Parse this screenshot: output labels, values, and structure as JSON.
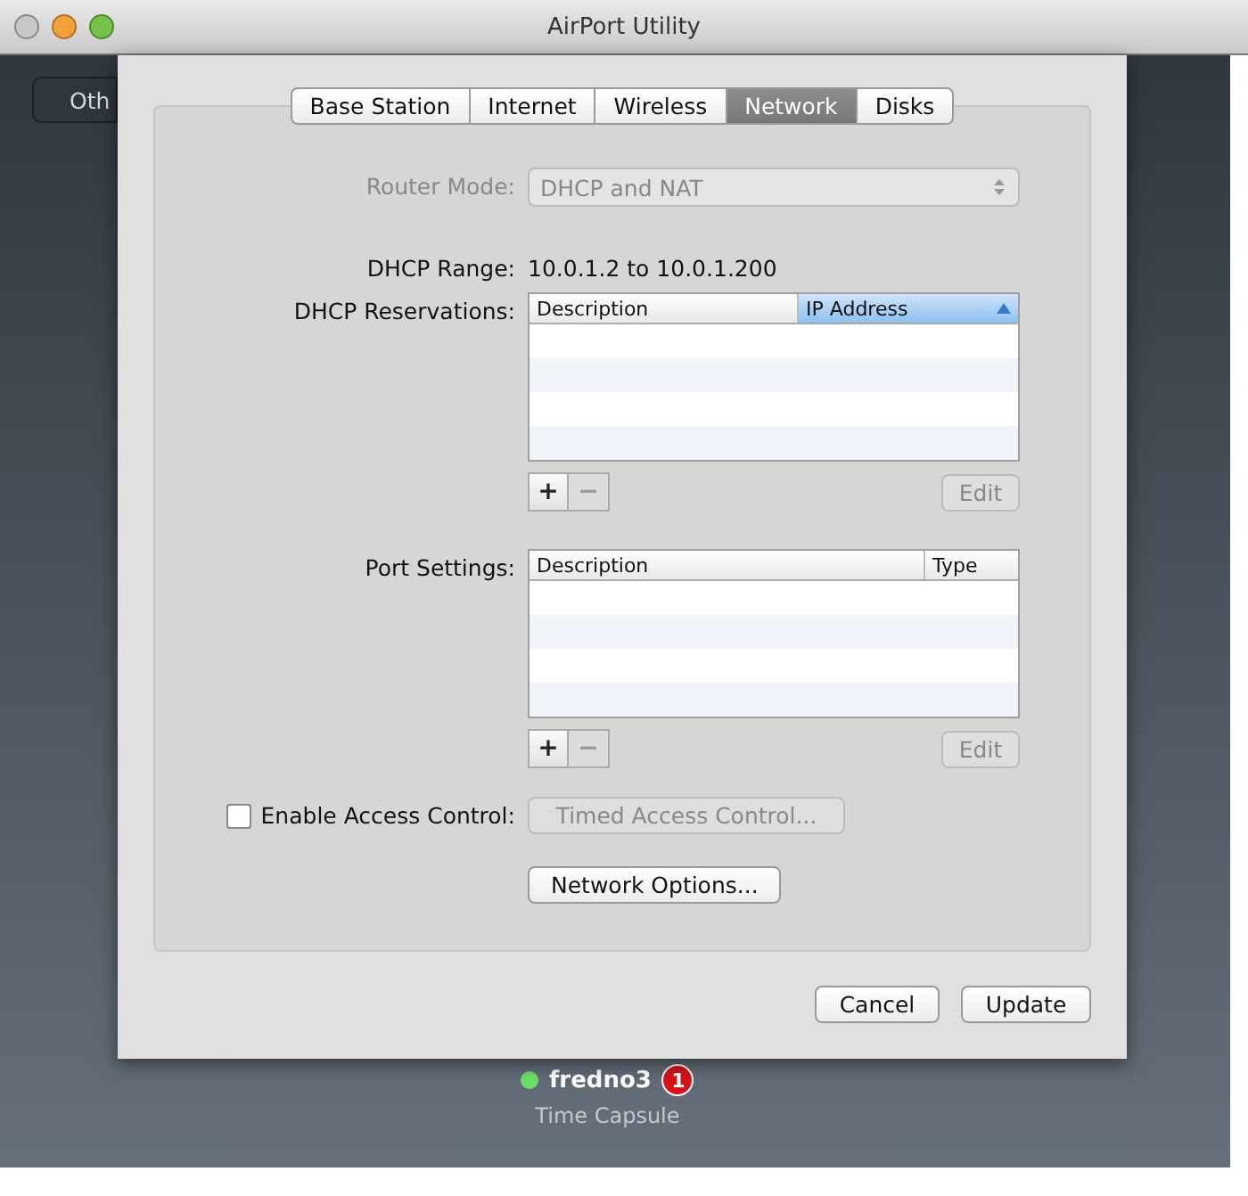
{
  "window": {
    "title": "AirPort Utility"
  },
  "background": {
    "button": "Oth",
    "device_name": "fredno3",
    "badge": "1",
    "device_model": "Time Capsule"
  },
  "tabs": [
    {
      "label": "Base Station",
      "selected": false
    },
    {
      "label": "Internet",
      "selected": false
    },
    {
      "label": "Wireless",
      "selected": false
    },
    {
      "label": "Network",
      "selected": true
    },
    {
      "label": "Disks",
      "selected": false
    }
  ],
  "router_mode": {
    "label": "Router Mode:",
    "value": "DHCP and NAT",
    "disabled": true
  },
  "dhcp_range": {
    "label": "DHCP Range:",
    "value": "10.0.1.2 to 10.0.1.200"
  },
  "dhcp_reservations": {
    "label": "DHCP Reservations:",
    "columns": [
      {
        "label": "Description",
        "selected": false
      },
      {
        "label": "IP Address",
        "selected": true
      }
    ],
    "buttons": [
      {
        "label": "+",
        "disabled": false
      },
      {
        "label": "−",
        "disabled": true
      }
    ],
    "edit": {
      "label": "Edit",
      "disabled": true
    }
  },
  "port_settings": {
    "label": "Port Settings:",
    "columns": [
      {
        "label": "Description",
        "selected": false
      },
      {
        "label": "Type",
        "selected": false
      }
    ],
    "buttons": [
      {
        "label": "+",
        "disabled": false
      },
      {
        "label": "−",
        "disabled": true
      }
    ],
    "edit": {
      "label": "Edit",
      "disabled": true
    }
  },
  "access_control": {
    "label": "Enable Access Control:",
    "checked": false,
    "timed_button": {
      "label": "Timed Access Control...",
      "disabled": true
    }
  },
  "network_options_button": "Network Options...",
  "buttons": [
    "Cancel",
    "Update"
  ]
}
